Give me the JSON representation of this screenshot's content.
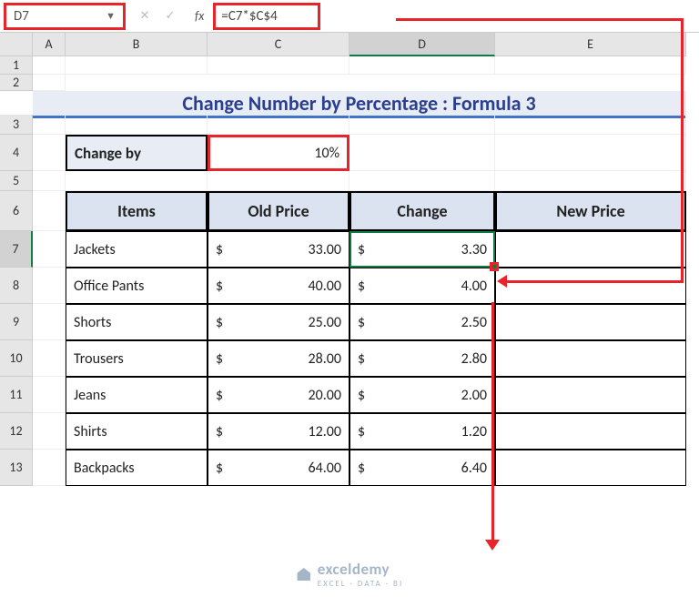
{
  "name_box": "D7",
  "formula": "=C7*$C$4",
  "columns": [
    "",
    "A",
    "B",
    "C",
    "D",
    "E"
  ],
  "rows": [
    "1",
    "2",
    "3",
    "4",
    "5",
    "6",
    "7",
    "8",
    "9",
    "10",
    "11",
    "12",
    "13"
  ],
  "title": "Change Number by Percentage : Formula 3",
  "change_by": {
    "label": "Change by",
    "value": "10%"
  },
  "headers": {
    "items": "Items",
    "old": "Old Price",
    "change": "Change",
    "new": "New Price"
  },
  "chart_data": {
    "type": "table",
    "columns": [
      "Items",
      "Old Price",
      "Change",
      "New Price"
    ],
    "rows": [
      {
        "item": "Jackets",
        "old": 33.0,
        "change": 3.3,
        "new": null
      },
      {
        "item": "Office Pants",
        "old": 40.0,
        "change": 4.0,
        "new": null
      },
      {
        "item": "Shorts",
        "old": 25.0,
        "change": 2.5,
        "new": null
      },
      {
        "item": "Trousers",
        "old": 28.0,
        "change": 2.8,
        "new": null
      },
      {
        "item": "Jeans",
        "old": 20.0,
        "change": 2.0,
        "new": null
      },
      {
        "item": "Shirts",
        "old": 12.0,
        "change": 1.2,
        "new": null
      },
      {
        "item": "Backpacks",
        "old": 64.0,
        "change": 6.4,
        "new": null
      }
    ]
  },
  "fmt": {
    "old": [
      "33.00",
      "40.00",
      "25.00",
      "28.00",
      "20.00",
      "12.00",
      "64.00"
    ],
    "change": [
      "3.30",
      "4.00",
      "2.50",
      "2.80",
      "2.00",
      "1.20",
      "6.40"
    ]
  },
  "currency": "$",
  "watermark": {
    "main": "exceldemy",
    "sub": "EXCEL · DATA · BI"
  }
}
